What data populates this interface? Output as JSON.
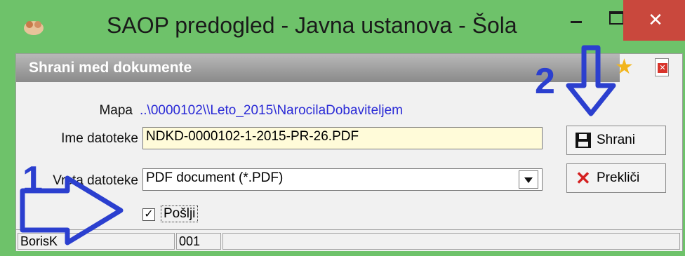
{
  "window": {
    "title": "SAOP predogled  - Javna ustanova - Šola",
    "close_glyph": "✕"
  },
  "panel": {
    "header": "Shrani med dokumente",
    "mapa_label": "Mapa",
    "mapa_value": "..\\0000102\\\\Leto_2015\\NarocilaDobaviteljem",
    "file_label": "Ime datoteke",
    "file_value": "NDKD-0000102-1-2015-PR-26.PDF",
    "type_label": "Vrsta datoteke",
    "type_value": "PDF document (*.PDF)",
    "send_label": "Pošlji",
    "send_checked": true,
    "send_check_glyph": "✓"
  },
  "buttons": {
    "save": "Shrani",
    "cancel": "Prekliči"
  },
  "status": {
    "user": "BorisK",
    "code": "001"
  },
  "annotations": {
    "one": "1",
    "two": "2",
    "color": "#2b3fcf"
  },
  "colors": {
    "titlebar": "#6ec26a",
    "close": "#c9483d",
    "input_highlight": "#fffbd9"
  }
}
